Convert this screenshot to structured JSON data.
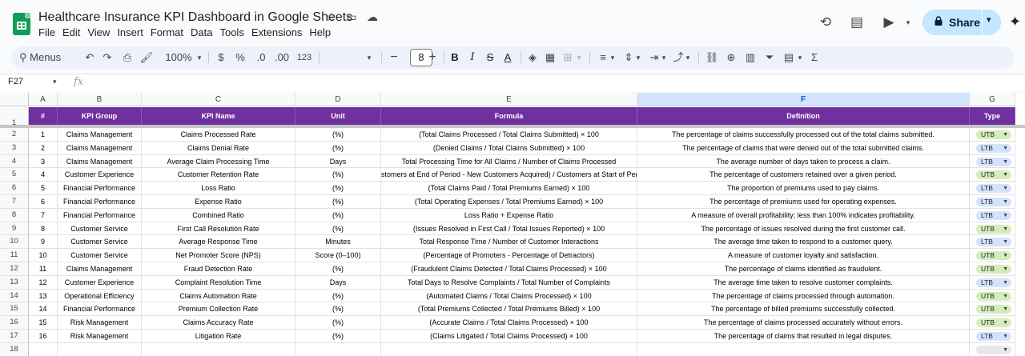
{
  "doc": {
    "title": "Healthcare Insurance KPI Dashboard in Google Sheets",
    "menus": [
      "File",
      "Edit",
      "View",
      "Insert",
      "Format",
      "Data",
      "Tools",
      "Extensions",
      "Help"
    ]
  },
  "header_actions": {
    "share_label": "Share"
  },
  "toolbar": {
    "search_label": "Menus",
    "zoom": "100%",
    "currency": "$",
    "percent": "%",
    "dec_decrease": ".0",
    "dec_increase": ".00",
    "number_format": "123",
    "font_size": "8"
  },
  "formula_bar": {
    "cell_ref": "F27",
    "fx": "fx"
  },
  "sheet": {
    "columns": [
      "A",
      "B",
      "C",
      "D",
      "E",
      "F",
      "G"
    ],
    "selected_column": "F",
    "headers": [
      "#",
      "KPI Group",
      "KPI Name",
      "Unit",
      "Formula",
      "Definition",
      "Type"
    ],
    "rows": [
      {
        "n": "1",
        "group": "Claims Management",
        "name": "Claims Processed Rate",
        "unit": "(%)",
        "formula": "(Total Claims Processed / Total Claims Submitted) × 100",
        "definition": "The percentage of claims successfully processed out of the total claims submitted.",
        "type": "UTB"
      },
      {
        "n": "2",
        "group": "Claims Management",
        "name": "Claims Denial Rate",
        "unit": "(%)",
        "formula": "(Denied Claims / Total Claims Submitted) × 100",
        "definition": "The percentage of claims that were denied out of the total submitted claims.",
        "type": "LTB"
      },
      {
        "n": "3",
        "group": "Claims Management",
        "name": "Average Claim Processing Time",
        "unit": "Days",
        "formula": "Total Processing Time for All Claims / Number of Claims Processed",
        "definition": "The average number of days taken to process a claim.",
        "type": "LTB"
      },
      {
        "n": "4",
        "group": "Customer Experience",
        "name": "Customer Retention Rate",
        "unit": "(%)",
        "formula": "stomers at End of Period - New Customers Acquired) / Customers at Start of Period) ×",
        "definition": "The percentage of customers retained over a given period.",
        "type": "UTB"
      },
      {
        "n": "5",
        "group": "Financial Performance",
        "name": "Loss Ratio",
        "unit": "(%)",
        "formula": "(Total Claims Paid / Total Premiums Earned) × 100",
        "definition": "The proportion of premiums used to pay claims.",
        "type": "LTB"
      },
      {
        "n": "6",
        "group": "Financial Performance",
        "name": "Expense Ratio",
        "unit": "(%)",
        "formula": "(Total Operating Expenses / Total Premiums Earned) × 100",
        "definition": "The percentage of premiums used for operating expenses.",
        "type": "LTB"
      },
      {
        "n": "7",
        "group": "Financial Performance",
        "name": "Combined Ratio",
        "unit": "(%)",
        "formula": "Loss Ratio + Expense Ratio",
        "definition": "A measure of overall profitability; less than 100% indicates profitability.",
        "type": "LTB"
      },
      {
        "n": "8",
        "group": "Customer Service",
        "name": "First Call Resolution Rate",
        "unit": "(%)",
        "formula": "(Issues Resolved in First Call / Total Issues Reported) × 100",
        "definition": "The percentage of issues resolved during the first customer call.",
        "type": "UTB"
      },
      {
        "n": "9",
        "group": "Customer Service",
        "name": "Average Response Time",
        "unit": "Minutes",
        "formula": "Total Response Time / Number of Customer Interactions",
        "definition": "The average time taken to respond to a customer query.",
        "type": "LTB"
      },
      {
        "n": "10",
        "group": "Customer Service",
        "name": "Net Promoter Score (NPS)",
        "unit": "Score (0–100)",
        "formula": "(Percentage of Promoters - Percentage of Detractors)",
        "definition": "A measure of customer loyalty and satisfaction.",
        "type": "UTB"
      },
      {
        "n": "11",
        "group": "Claims Management",
        "name": "Fraud Detection Rate",
        "unit": "(%)",
        "formula": "(Fraudulent Claims Detected / Total Claims Processed) × 100",
        "definition": "The percentage of claims identified as fraudulent.",
        "type": "UTB"
      },
      {
        "n": "12",
        "group": "Customer Experience",
        "name": "Complaint Resolution Time",
        "unit": "Days",
        "formula": "Total Days to Resolve Complaints / Total Number of Complaints",
        "definition": "The average time taken to resolve customer complaints.",
        "type": "LTB"
      },
      {
        "n": "13",
        "group": "Operational Efficiency",
        "name": "Claims Automation Rate",
        "unit": "(%)",
        "formula": "(Automated Claims / Total Claims Processed) × 100",
        "definition": "The percentage of claims processed through automation.",
        "type": "UTB"
      },
      {
        "n": "14",
        "group": "Financial Performance",
        "name": "Premium Collection Rate",
        "unit": "(%)",
        "formula": "(Total Premiums Collected / Total Premiums Billed) × 100",
        "definition": "The percentage of billed premiums successfully collected.",
        "type": "UTB"
      },
      {
        "n": "15",
        "group": "Risk Management",
        "name": "Claims Accuracy Rate",
        "unit": "(%)",
        "formula": "(Accurate Claims / Total Claims Processed) × 100",
        "definition": "The percentage of claims processed accurately without errors.",
        "type": "UTB"
      },
      {
        "n": "16",
        "group": "Risk Management",
        "name": "Litigation Rate",
        "unit": "(%)",
        "formula": "(Claims Litigated / Total Claims Processed) × 100",
        "definition": "The percentage of claims that resulted in legal disputes.",
        "type": "LTB"
      }
    ],
    "row_numbers": [
      "1",
      "2",
      "3",
      "4",
      "5",
      "6",
      "7",
      "8",
      "9",
      "10",
      "11",
      "12",
      "13",
      "14",
      "15",
      "16",
      "17",
      "18"
    ]
  },
  "colors": {
    "header_bg": "#7030a0",
    "utb_chip": "#d4edbc",
    "ltb_chip": "#d3e3fd",
    "share_bg": "#c2e7ff",
    "sheets_green": "#0f9d58"
  }
}
